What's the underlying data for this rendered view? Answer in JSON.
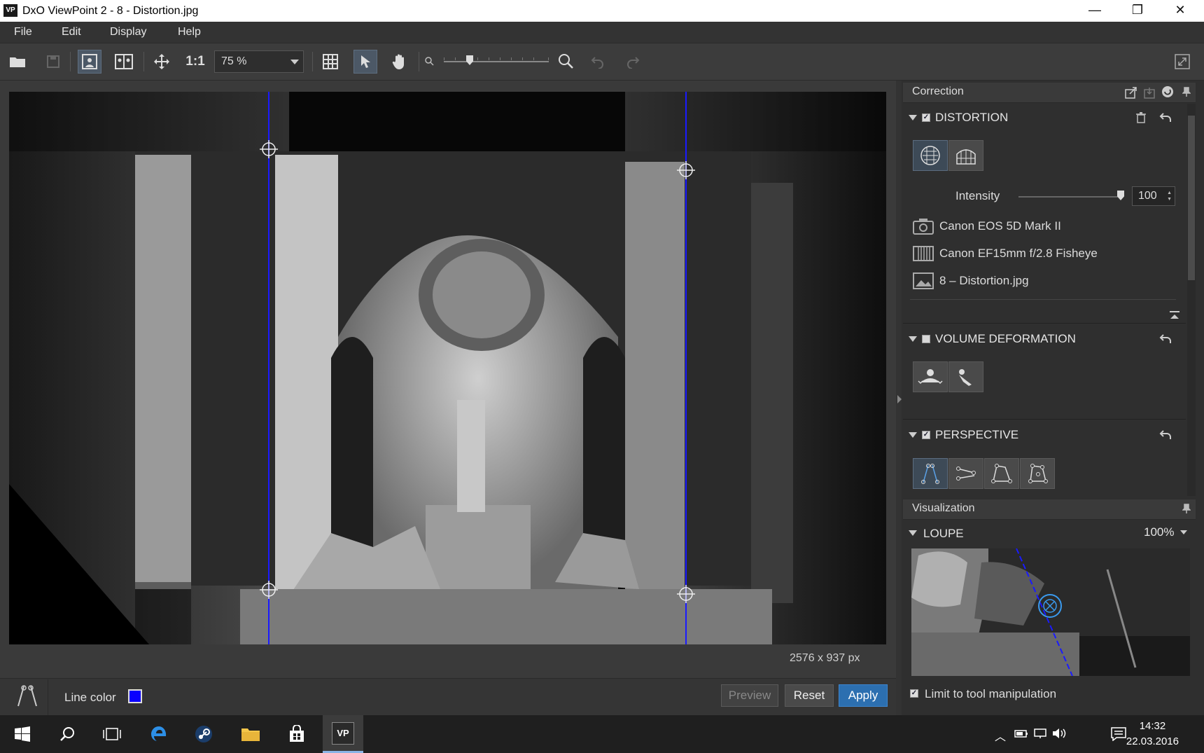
{
  "window": {
    "app_icon": "VP",
    "title": "DxO ViewPoint 2 - 8 - Distortion.jpg",
    "minimize": "—",
    "maximize": "❐",
    "close": "✕"
  },
  "menu": [
    "File",
    "Edit",
    "Display",
    "Help"
  ],
  "toolbar": {
    "one_to_one": "1:1",
    "zoom_value": "75 %"
  },
  "canvas": {
    "dimensions": "2576 x 937 px"
  },
  "bottom": {
    "line_color_label": "Line color",
    "line_color": "#0a00ff",
    "preview": "Preview",
    "reset": "Reset",
    "apply": "Apply"
  },
  "correction": {
    "title": "Correction",
    "distortion": {
      "label": "DISTORTION",
      "intensity_label": "Intensity",
      "intensity_value": "100",
      "camera": "Canon EOS 5D Mark II",
      "lens": "Canon EF15mm f/2.8 Fisheye",
      "file": "8 – Distortion.jpg"
    },
    "volume": {
      "label": "VOLUME DEFORMATION"
    },
    "perspective": {
      "label": "PERSPECTIVE"
    }
  },
  "visualization": {
    "title": "Visualization",
    "loupe_label": "LOUPE",
    "loupe_zoom": "100%",
    "limit_label": "Limit to tool manipulation"
  },
  "taskbar": {
    "time": "14:32",
    "date": "22.03.2016",
    "vp_label": "VP"
  },
  "accent": "#2c6fb0"
}
